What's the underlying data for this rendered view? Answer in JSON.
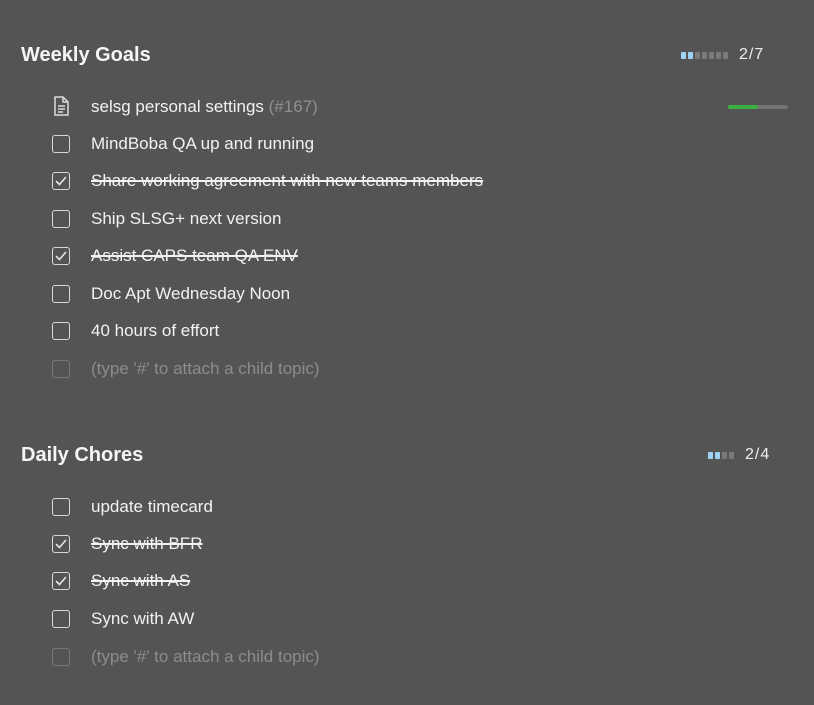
{
  "sections": [
    {
      "title": "Weekly Goals",
      "progress_label": "2/7",
      "progress_done": 2,
      "progress_total": 7,
      "items": [
        {
          "type": "topic",
          "label": "selsg personal settings",
          "ref": "(#167)",
          "icon": "document-icon",
          "progress": 0.5
        },
        {
          "type": "task",
          "label": "MindBoba QA up and running",
          "checked": false
        },
        {
          "type": "task",
          "label": "Share working agreement with new teams members",
          "checked": true
        },
        {
          "type": "task",
          "label": "Ship SLSG+ next version",
          "checked": false
        },
        {
          "type": "task",
          "label": "Assist CAPS team QA ENV",
          "checked": true
        },
        {
          "type": "task",
          "label": "Doc Apt Wednesday Noon",
          "checked": false
        },
        {
          "type": "task",
          "label": "40 hours of effort",
          "checked": false
        },
        {
          "type": "placeholder",
          "label": "(type '#' to attach a child topic)"
        }
      ]
    },
    {
      "title": "Daily Chores",
      "progress_label": "2/4",
      "progress_done": 2,
      "progress_total": 4,
      "items": [
        {
          "type": "task",
          "label": "update timecard",
          "checked": false
        },
        {
          "type": "task",
          "label": "Sync with BFR",
          "checked": true
        },
        {
          "type": "task",
          "label": "Sync with AS",
          "checked": true
        },
        {
          "type": "task",
          "label": "Sync with AW",
          "checked": false
        },
        {
          "type": "placeholder",
          "label": "(type '#' to attach a child topic)"
        }
      ]
    }
  ],
  "colors": {
    "background": "#545454",
    "pip_done": "#9fd3f5",
    "pip_todo": "#7a7a7a",
    "topic_progress": "#3cb043"
  }
}
